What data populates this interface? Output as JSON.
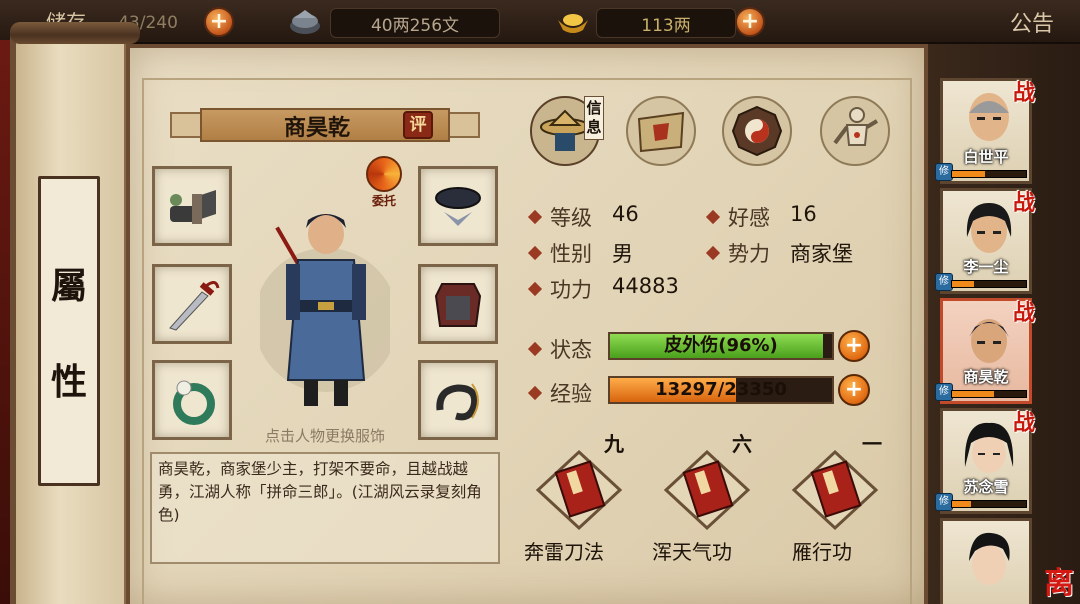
{
  "topbar": {
    "inventory_label": "储存",
    "inventory_count": "43/240",
    "money": "40两256文",
    "gold": "113两",
    "notice": "公告"
  },
  "side_tab": {
    "char1": "屬",
    "char2": "性"
  },
  "hero": {
    "name": "商昊乾",
    "rate_label": "评",
    "delegate_label": "委托",
    "change_hint": "点击人物更换服饰",
    "description": "商昊乾，商家堡少主，打架不要命，且越战越勇，江湖人称「拼命三郎」。(江湖风云录复刻角色)"
  },
  "tabs": {
    "info_label": "信息",
    "icons": [
      "hat-icon",
      "map-scroll-icon",
      "bagua-icon",
      "meridian-figure-icon"
    ]
  },
  "stats": {
    "level_label": "等级",
    "level": "46",
    "favor_label": "好感",
    "favor": "16",
    "gender_label": "性别",
    "gender": "男",
    "faction_label": "势力",
    "faction": "商家堡",
    "power_label": "功力",
    "power": "44883",
    "status_label": "状态",
    "status_text": "皮外伤(96%)",
    "status_fraction": 0.96,
    "exp_label": "经验",
    "exp_text": "13297/23350",
    "exp_fraction": 0.5695
  },
  "skills": [
    {
      "rank": "九",
      "name": "奔雷刀法"
    },
    {
      "rank": "六",
      "name": "浑天气功"
    },
    {
      "rank": "一",
      "name": "雁行功"
    }
  ],
  "roster": [
    {
      "name": "白世平",
      "battle": "战",
      "cultivate": "修",
      "xp": 0.45
    },
    {
      "name": "李一尘",
      "battle": "战",
      "cultivate": "修",
      "xp": 0.3
    },
    {
      "name": "商昊乾",
      "battle": "战",
      "cultivate": "修",
      "xp": 0.57
    },
    {
      "name": "苏念雪",
      "battle": "战",
      "cultivate": "修",
      "xp": 0.25
    },
    {
      "name": "",
      "battle": "",
      "cultivate": "",
      "xp": 0
    }
  ],
  "leave_label": "离",
  "colors": {
    "status_bar": "#5fb42a",
    "exp_bar": "#e8851a",
    "accent_red": "#c8180c"
  }
}
